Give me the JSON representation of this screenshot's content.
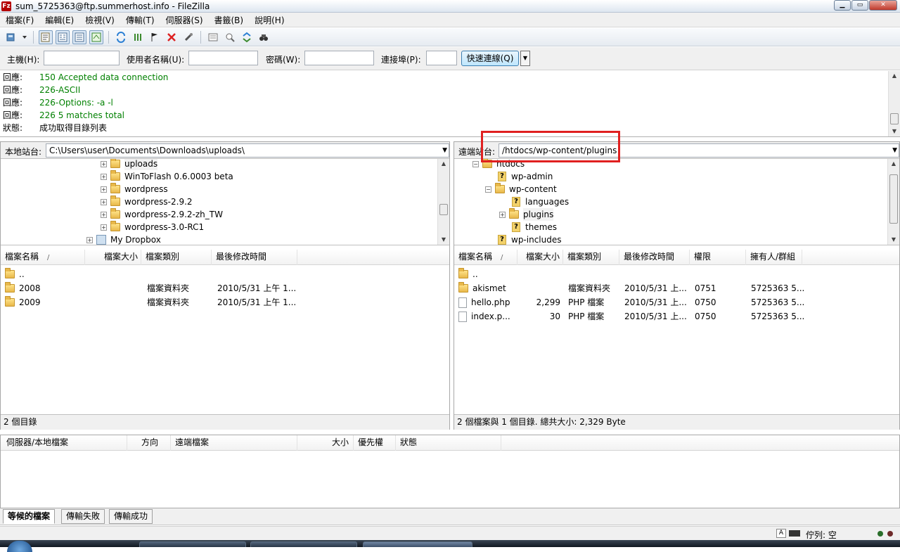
{
  "window": {
    "app_icon": "Fz",
    "title": "sum_5725363@ftp.summerhost.info - FileZilla",
    "buttons": {
      "minimize": "▁",
      "maximize": "▭",
      "close": "✕"
    }
  },
  "menu": [
    "檔案(F)",
    "編輯(E)",
    "檢視(V)",
    "傳輸(T)",
    "伺服器(S)",
    "書籤(B)",
    "說明(H)"
  ],
  "toolbar": {
    "icons": [
      "site-manager-icon",
      "dropdown-arrow-icon",
      "toggle-message-log-icon",
      "toggle-local-tree-icon",
      "toggle-remote-tree-icon",
      "toggle-transfer-queue-icon",
      "refresh-icon",
      "process-queue-icon",
      "cancel-operation-icon",
      "disconnect-icon",
      "reconnect-icon",
      "directory-listing-filters-icon",
      "directory-comparison-icon",
      "sync-browsing-icon",
      "search-remote-files-icon"
    ]
  },
  "quickconnect": {
    "host_label": "主機(H):",
    "user_label": "使用者名稱(U):",
    "pass_label": "密碼(W):",
    "port_label": "連接埠(P):",
    "button": "快速連線(Q)",
    "dropdown": "▼"
  },
  "log": [
    {
      "type": "回應:",
      "msg": "150 Accepted data connection",
      "color": "#008000"
    },
    {
      "type": "回應:",
      "msg": "226-ASCII",
      "color": "#008000"
    },
    {
      "type": "回應:",
      "msg": "226-Options: -a -l",
      "color": "#008000"
    },
    {
      "type": "回應:",
      "msg": "226 5 matches total",
      "color": "#008000"
    },
    {
      "type": "狀態:",
      "msg": "成功取得目錄列表",
      "color": "#000000"
    }
  ],
  "local": {
    "site_label": "本地站台:",
    "path": "C:\\Users\\user\\Documents\\Downloads\\uploads\\",
    "tree": [
      {
        "label": "uploads"
      },
      {
        "label": "WinToFlash 0.6.0003 beta"
      },
      {
        "label": "wordpress"
      },
      {
        "label": "wordpress-2.9.2"
      },
      {
        "label": "wordpress-2.9.2-zh_TW"
      },
      {
        "label": "wordpress-3.0-RC1"
      },
      {
        "label": "My Dropbox"
      }
    ],
    "columns": [
      "檔案名稱",
      "/",
      "檔案大小",
      "檔案類別",
      "最後修改時間"
    ],
    "files": [
      {
        "name": "..",
        "size": "",
        "type": "",
        "modified": ""
      },
      {
        "name": "2008",
        "size": "",
        "type": "檔案資料夾",
        "modified": "2010/5/31 上午 1..."
      },
      {
        "name": "2009",
        "size": "",
        "type": "檔案資料夾",
        "modified": "2010/5/31 上午 1..."
      }
    ],
    "status": "2 個目錄"
  },
  "remote": {
    "site_label": "遠端站台:",
    "path": "/htdocs/wp-content/plugins",
    "tree": [
      {
        "label": "htdocs"
      },
      {
        "label": "wp-admin"
      },
      {
        "label": "wp-content"
      },
      {
        "label": "languages"
      },
      {
        "label": "plugins"
      },
      {
        "label": "themes"
      },
      {
        "label": "wp-includes"
      }
    ],
    "columns": [
      "檔案名稱",
      "/",
      "檔案大小",
      "檔案類別",
      "最後修改時間",
      "權限",
      "擁有人/群組"
    ],
    "files": [
      {
        "name": "..",
        "size": "",
        "type": "",
        "modified": "",
        "perms": "",
        "owner": ""
      },
      {
        "name": "akismet",
        "size": "",
        "type": "檔案資料夾",
        "modified": "2010/5/31 上...",
        "perms": "0751",
        "owner": "5725363 5..."
      },
      {
        "name": "hello.php",
        "size": "2,299",
        "type": "PHP 檔案",
        "modified": "2010/5/31 上...",
        "perms": "0750",
        "owner": "5725363 5..."
      },
      {
        "name": "index.p...",
        "size": "30",
        "type": "PHP 檔案",
        "modified": "2010/5/31 上...",
        "perms": "0750",
        "owner": "5725363 5..."
      }
    ],
    "status": "2 個檔案與 1 個目錄. 總共大小: 2,329 Byte"
  },
  "queue": {
    "columns": [
      "伺服器/本地檔案",
      "方向",
      "遠端檔案",
      "大小",
      "優先權",
      "狀態"
    ],
    "tabs": [
      "等候的檔案",
      "傳輸失敗",
      "傳輸成功"
    ]
  },
  "statusbar": {
    "queue_text": "佇列: 空"
  },
  "highlight_color": "#e02020"
}
